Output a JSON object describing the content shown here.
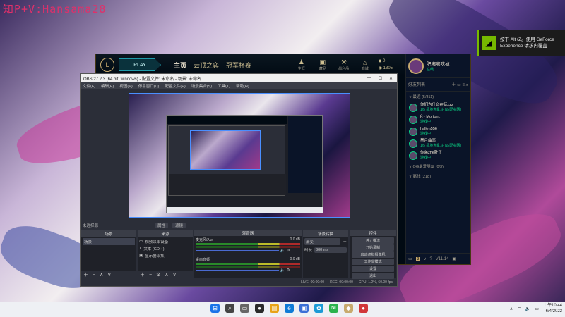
{
  "watermark": "知P+V:Hansama28",
  "geforce": {
    "text_line1": "按下 Alt+Z。使用 GeForce",
    "text_line2": "Experience 请求内覆盖",
    "logo_icon": "nvidia-icon"
  },
  "lol": {
    "play_label": "PLAY",
    "nav": [
      "主页",
      "云顶之弈",
      "冠军杯赛"
    ],
    "active_nav": 0,
    "icons": [
      {
        "name": "profile-icon",
        "label": "生涯"
      },
      {
        "name": "collection-icon",
        "label": "藏品"
      },
      {
        "name": "loot-icon",
        "label": "战利品"
      },
      {
        "name": "store-icon",
        "label": "商城"
      }
    ],
    "currency": {
      "rp": "0",
      "be": "1305"
    },
    "profile": {
      "name": "肥嘟嘟吃掉",
      "status": "在线"
    },
    "friends_header": "好友列表",
    "groups": [
      {
        "label": "∨ 最近 (5/311)"
      },
      {
        "label": "∨ OG最爱朋友 (0/3)"
      },
      {
        "label": "∨ 离线 (218)"
      }
    ],
    "friends": [
      {
        "name": "你们为什么在玩zzz",
        "status": "1/5 极地大乱斗 (匹配实网)"
      },
      {
        "name": "Ǩ~ Morton...",
        "status": "游戏中"
      },
      {
        "name": "hallen556",
        "status": "游戏中"
      },
      {
        "name": "黑月曲率",
        "status": "1/5 极地大乱斗 (匹配实网)"
      },
      {
        "name": "你弟zhe肚了",
        "status": "游戏中"
      }
    ],
    "bottom_badge": "3",
    "bottom_version": "V11.14"
  },
  "obs": {
    "title": "OBS 27.2.3 (64 bit, windows) - 配置文件: 未命名 - 场景: 未命名",
    "menu": [
      "文件(F)",
      "编辑(E)",
      "视图(V)",
      "停靠窗口(D)",
      "配置文件(P)",
      "场景集合(S)",
      "工具(T)",
      "帮助(H)"
    ],
    "preview_label": "未选择源",
    "preview_buttons": [
      "属性",
      "滤镜"
    ],
    "docks": {
      "scenes": {
        "title": "场景",
        "items": [
          "场景"
        ]
      },
      "sources": {
        "title": "来源",
        "items": [
          "视频采集设备",
          "文本 (GDI+)",
          "显示器采集"
        ]
      },
      "mixer": {
        "title": "混音器",
        "rows": [
          {
            "name": "麦克风/Aux",
            "db": "0.0 dB"
          },
          {
            "name": "桌面音频",
            "db": "0.0 dB"
          }
        ]
      },
      "transitions": {
        "title": "场景转换",
        "type": "渐变",
        "duration_label": "时长",
        "duration": "300 ms"
      },
      "controls": {
        "title": "控件",
        "buttons": [
          "停止推流",
          "开始录制",
          "启动虚拟摄像机",
          "工作室模式",
          "设置",
          "退出"
        ]
      }
    },
    "status": {
      "live": "LIVE: 00:00:00",
      "rec": "REC: 00:00:00",
      "cpu": "CPU: 1.2%, 60.00 fps"
    }
  },
  "taskbar": {
    "apps": [
      {
        "name": "windows-start-icon",
        "color": "#1a73e8",
        "glyph": "⊞"
      },
      {
        "name": "search-icon",
        "color": "#444444",
        "glyph": "⌕"
      },
      {
        "name": "task-view-icon",
        "color": "#666666",
        "glyph": "▭"
      },
      {
        "name": "obs-icon",
        "color": "#2a2a2a",
        "glyph": "●"
      },
      {
        "name": "file-explorer-icon",
        "color": "#e8a317",
        "glyph": "▤"
      },
      {
        "name": "edge-icon",
        "color": "#0f7bd6",
        "glyph": "e"
      },
      {
        "name": "store-app-icon",
        "color": "#3b6fd6",
        "glyph": "▣"
      },
      {
        "name": "photos-icon",
        "color": "#1b9ad6",
        "glyph": "✿"
      },
      {
        "name": "wechat-icon",
        "color": "#2bb24c",
        "glyph": "✉"
      },
      {
        "name": "lol-icon",
        "color": "#c8aa6e",
        "glyph": "◆"
      },
      {
        "name": "riot-icon",
        "color": "#d13639",
        "glyph": "●"
      }
    ],
    "clock_time": "上午10:44",
    "clock_date": "6/4/2022"
  }
}
